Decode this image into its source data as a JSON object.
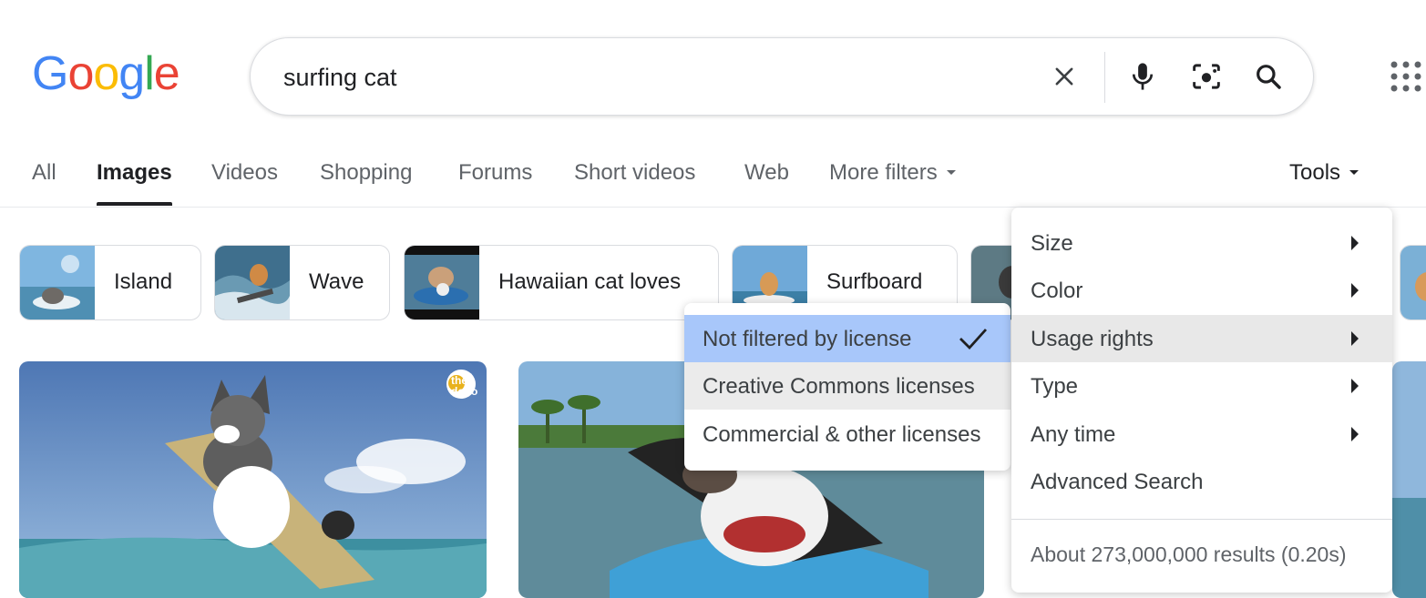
{
  "search": {
    "query": "surfing cat"
  },
  "icons": {
    "clear": "close-icon",
    "voice": "microphone-icon",
    "lens": "camera-lens-icon",
    "search": "search-icon",
    "apps": "apps-grid-icon",
    "check": "check-icon"
  },
  "tabs": [
    {
      "label": "All"
    },
    {
      "label": "Images"
    },
    {
      "label": "Videos"
    },
    {
      "label": "Shopping"
    },
    {
      "label": "Forums"
    },
    {
      "label": "Short videos"
    },
    {
      "label": "Web"
    },
    {
      "label": "More filters"
    }
  ],
  "tools_label": "Tools",
  "chips": [
    {
      "label": "Island"
    },
    {
      "label": "Wave"
    },
    {
      "label": "Hawaiian cat loves"
    },
    {
      "label": "Surfboard"
    }
  ],
  "results": {
    "watermark": "the dodo"
  },
  "tools_menu": {
    "items": [
      {
        "label": "Size"
      },
      {
        "label": "Color"
      },
      {
        "label": "Usage rights"
      },
      {
        "label": "Type"
      },
      {
        "label": "Any time"
      },
      {
        "label": "Advanced Search"
      }
    ],
    "stats": "About 273,000,000 results (0.20s)"
  },
  "usage_rights_menu": {
    "items": [
      {
        "label": "Not filtered by license"
      },
      {
        "label": "Creative Commons licenses"
      },
      {
        "label": "Commercial & other licenses"
      }
    ]
  },
  "colors": {
    "google_blue": "#4285f4",
    "google_red": "#ea4335",
    "google_yellow": "#fbbc05",
    "google_green": "#34a853",
    "selected_bg": "#a8c7fa"
  }
}
